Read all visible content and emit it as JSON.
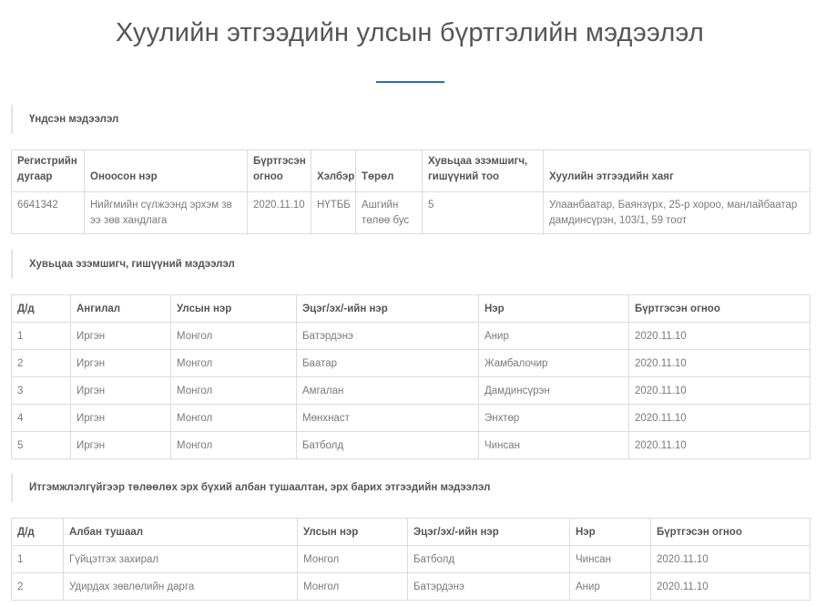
{
  "page": {
    "title": "Хуулийн этгээдийн улсын бүртгэлийн мэдээлэл",
    "accent_color": "#2f6ea7"
  },
  "basic": {
    "heading": "Үндсэн мэдээлэл",
    "headers": [
      "Регистрийн дугаар",
      "Оноосон нэр",
      "Бүртгэсэн огноо",
      "Хэлбэр",
      "Төрөл",
      "Хувьцаа эзэмшигч, гишүүний тоо",
      "Хуулийн этгээдийн хаяг"
    ],
    "row": [
      "6641342",
      "Нийгмийн сүлжээнд эрхэм зв ээ зөв хандлага",
      "2020.11.10",
      "НҮТББ",
      "Ашгийн төлөө бус",
      "5",
      "Улаанбаатар, Баянзүрх, 25-р хороо, манлайбаатар дамдинсүрэн, 103/1, 59 тоот"
    ]
  },
  "shareholders": {
    "heading": "Хувьцаа эзэмшигч, гишүүний мэдээлэл",
    "headers": [
      "Д/д",
      "Ангилал",
      "Улсын нэр",
      "Эцэг/эх/-ийн нэр",
      "Нэр",
      "Бүртгэсэн огноо"
    ],
    "rows": [
      [
        "1",
        "Иргэн",
        "Монгол",
        "Батэрдэнэ",
        "Анир",
        "2020.11.10"
      ],
      [
        "2",
        "Иргэн",
        "Монгол",
        "Баатар",
        "Жамбалочир",
        "2020.11.10"
      ],
      [
        "3",
        "Иргэн",
        "Монгол",
        "Амгалан",
        "Дамдинсүрэн",
        "2020.11.10"
      ],
      [
        "4",
        "Иргэн",
        "Монгол",
        "Мөнхнаст",
        "Энхтөр",
        "2020.11.10"
      ],
      [
        "5",
        "Иргэн",
        "Монгол",
        "Батболд",
        "Чинсан",
        "2020.11.10"
      ]
    ]
  },
  "officials": {
    "heading": "Итгэмжлэлгүйгээр төлөөлөх эрх бүхий албан тушаалтан, эрх барих этгээдийн мэдээлэл",
    "headers": [
      "Д/д",
      "Албан тушаал",
      "Улсын нэр",
      "Эцэг/эх/-ийн нэр",
      "Нэр",
      "Бүртгэсэн огноо"
    ],
    "rows": [
      [
        "1",
        "Гүйцэтгэх захирал",
        "Монгол",
        "Батболд",
        "Чинсан",
        "2020.11.10"
      ],
      [
        "2",
        "Удирдах зөвлөлийн дарга",
        "Монгол",
        "Батэрдэнэ",
        "Анир",
        "2020.11.10"
      ]
    ]
  }
}
